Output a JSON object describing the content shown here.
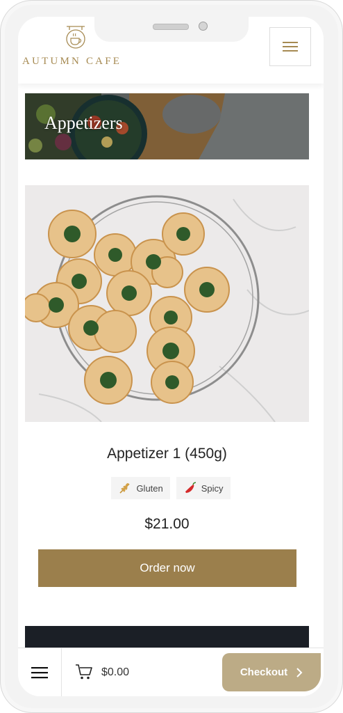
{
  "header": {
    "logo_text": "AUTUMN CAFE",
    "logo_icon": "coffee-cup-icon",
    "menu_icon": "hamburger-menu-icon"
  },
  "banner": {
    "title": "Appetizers"
  },
  "product": {
    "name": "Appetizer 1 (450g)",
    "tags": [
      {
        "label": "Gluten",
        "icon": "wheat-icon"
      },
      {
        "label": "Spicy",
        "icon": "chili-pepper-icon"
      }
    ],
    "price": "$21.00",
    "order_label": "Order now"
  },
  "bottom_bar": {
    "menu_icon": "hamburger-menu-icon",
    "cart_icon": "shopping-cart-icon",
    "cart_total": "$0.00",
    "checkout_label": "Checkout",
    "checkout_icon": "chevron-right-icon"
  },
  "colors": {
    "accent": "#9b7f4c",
    "logo": "#a68a52",
    "checkout": "#bcab86"
  }
}
